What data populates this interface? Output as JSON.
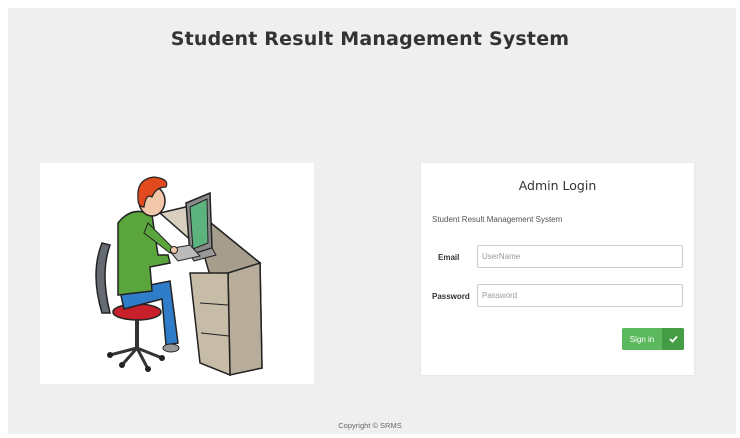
{
  "header": {
    "title": "Student Result Management System"
  },
  "login": {
    "title": "Admin Login",
    "subtitle": "Student Result Management System",
    "email_label": "Email",
    "email_placeholder": "UserName",
    "password_label": "Password",
    "password_placeholder": "Password",
    "signin_label": "Sign in",
    "signin_icon": "check-icon"
  },
  "footer": {
    "text": "Copyright © SRMS"
  },
  "colors": {
    "background": "#efefef",
    "card": "#ffffff",
    "button_green": "#5cb85c",
    "button_green_dark": "#449d44"
  }
}
